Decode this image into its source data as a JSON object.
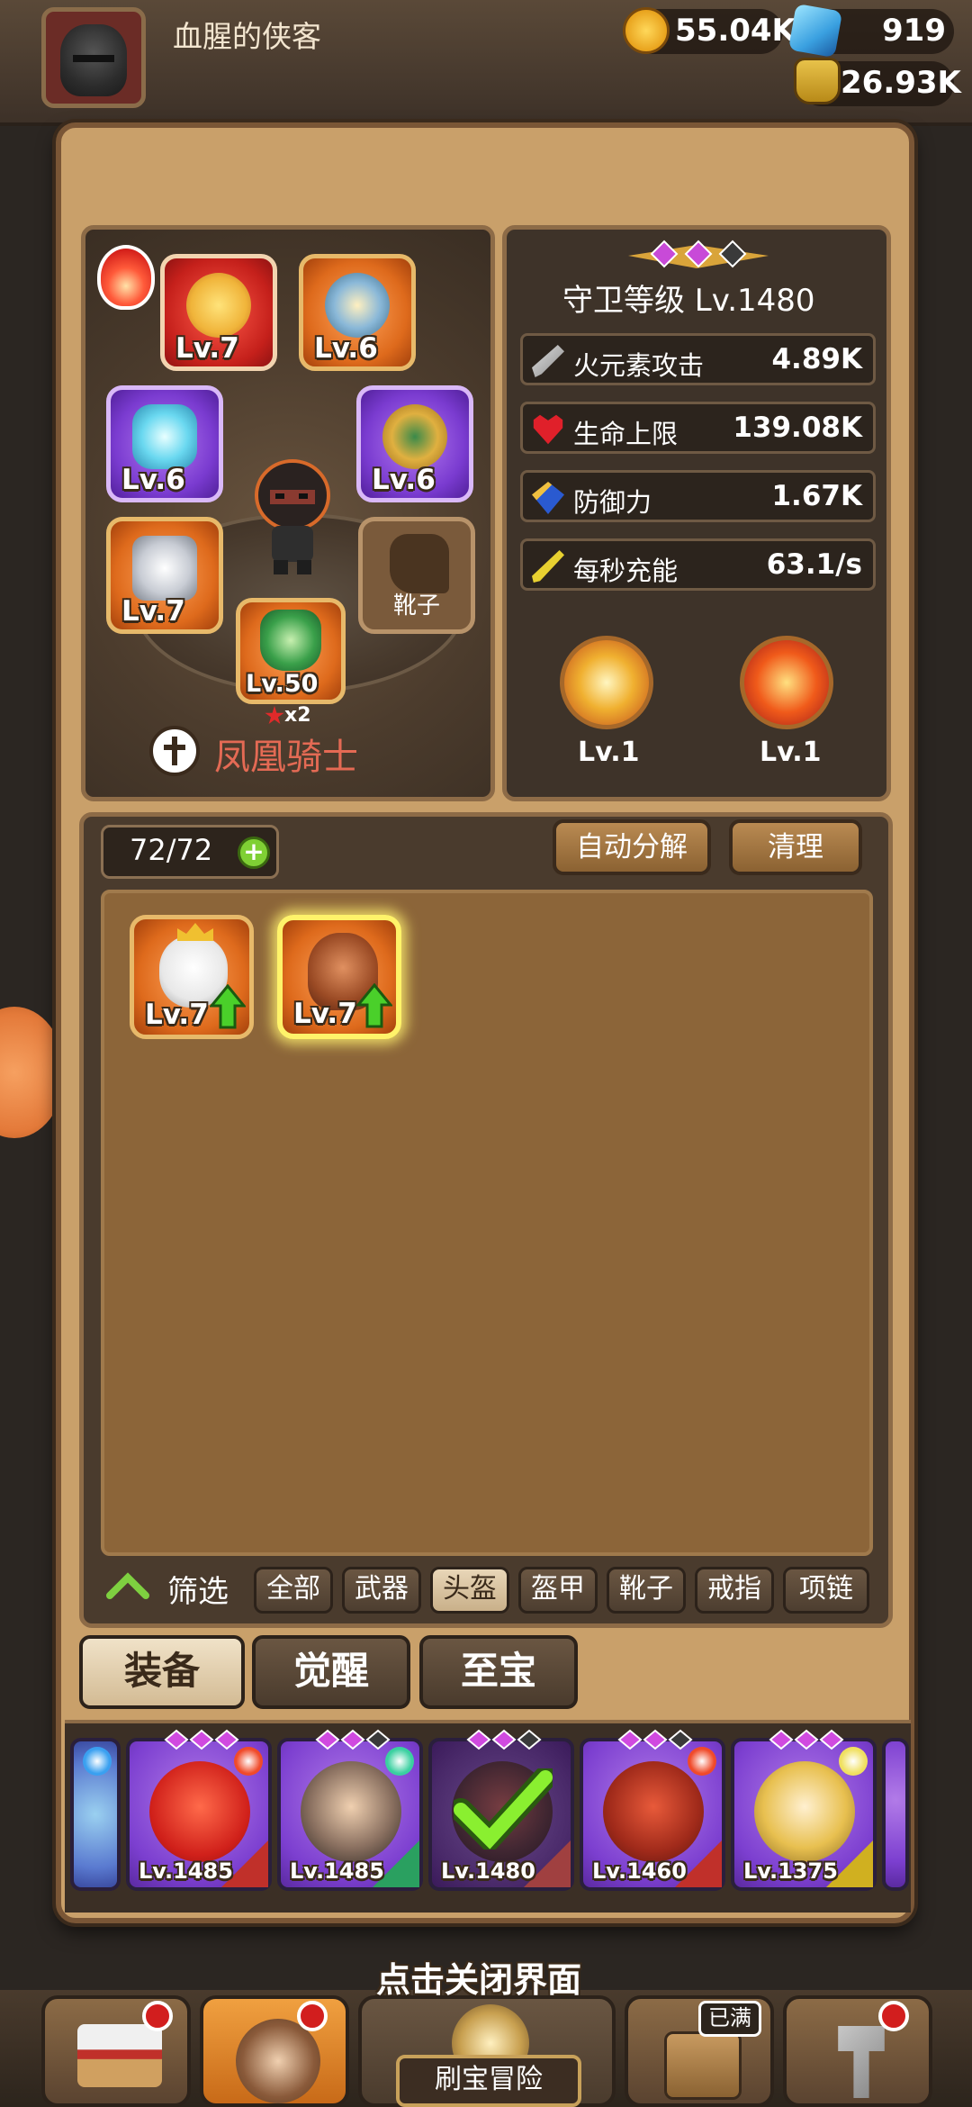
{
  "player": {
    "name": "血腥的侠客"
  },
  "resources": {
    "gold": "55.04K",
    "gems": "919",
    "potion": "26.93K"
  },
  "equipment": {
    "slots": [
      {
        "name": "pizza",
        "level": "Lv.7"
      },
      {
        "name": "necklace",
        "level": "Lv.6"
      },
      {
        "name": "crown",
        "level": "Lv.6"
      },
      {
        "name": "ring",
        "level": "Lv.6"
      },
      {
        "name": "armor",
        "level": "Lv.7"
      },
      {
        "name": "boots",
        "label": "靴子"
      },
      {
        "name": "helmet",
        "level": "Lv.50",
        "star": "x2"
      }
    ],
    "class_name": "凤凰骑士"
  },
  "stats": {
    "guard_level": "守卫等级 Lv.1480",
    "rows": [
      {
        "label": "火元素攻击",
        "value": "4.89K"
      },
      {
        "label": "生命上限",
        "value": "139.08K"
      },
      {
        "label": "防御力",
        "value": "1.67K"
      },
      {
        "label": "每秒充能",
        "value": "63.1/s"
      }
    ],
    "skills": [
      {
        "level": "Lv.1"
      },
      {
        "level": "Lv.1"
      }
    ]
  },
  "inventory": {
    "count": "72/72",
    "auto_decompose": "自动分解",
    "clear": "清理",
    "items": [
      {
        "level": "Lv.7"
      },
      {
        "level": "Lv.7"
      }
    ]
  },
  "filter": {
    "label": "筛选",
    "options": [
      "全部",
      "武器",
      "头盔",
      "盔甲",
      "靴子",
      "戒指",
      "项链"
    ],
    "selected": "头盔"
  },
  "tabs": [
    "装备",
    "觉醒",
    "至宝"
  ],
  "heroes": [
    {
      "level": "Lv.1485"
    },
    {
      "level": "Lv.1485"
    },
    {
      "level": "Lv.1480"
    },
    {
      "level": "Lv.1460"
    },
    {
      "level": "Lv.1375"
    }
  ],
  "close_hint": "点击关闭界面",
  "bottom_nav": {
    "full_badge": "已满",
    "adventure": "刷宝冒险"
  },
  "colors": {
    "panel_bg": "#c9a06a",
    "rarity_orange": "#de6a1c",
    "rarity_purple": "#7a3bd0",
    "rarity_red": "#c5201b",
    "class_name": "#e46a54",
    "plus_green": "#7fd034"
  }
}
